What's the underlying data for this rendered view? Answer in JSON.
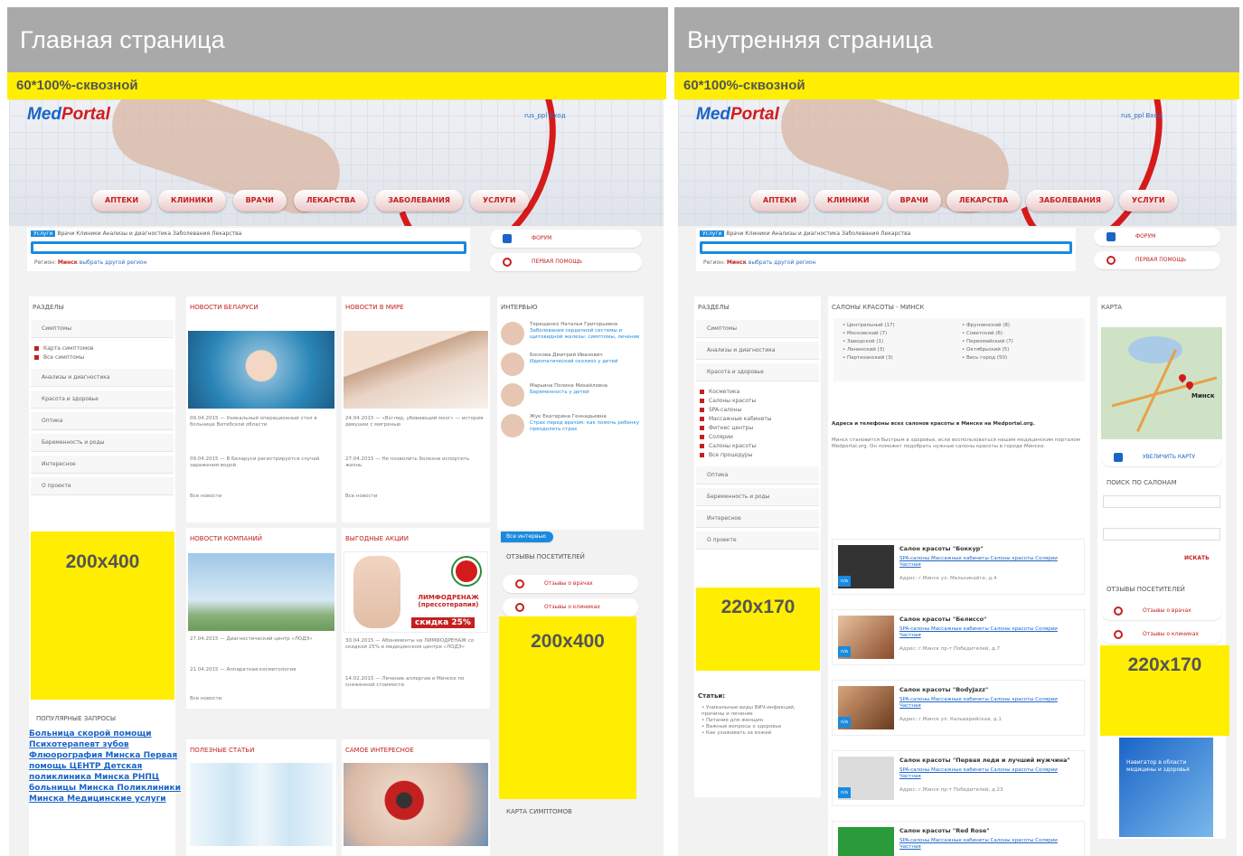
{
  "headers": {
    "main": "Главная страница",
    "inner": "Внутренняя страница"
  },
  "banners": {
    "main": "60*100%-сквозной",
    "inner": "60*100%-сквозной"
  },
  "logo": {
    "med": "Med",
    "portal": "Portal"
  },
  "nav": [
    "АПТЕКИ",
    "КЛИНИКИ",
    "ВРАЧИ",
    "ЛЕКАРСТВА",
    "ЗАБОЛЕВАНИЯ",
    "УСЛУГИ"
  ],
  "search": {
    "tabs": [
      "Услуги",
      "Врачи",
      "Клиники",
      "Анализы и диагностика",
      "Заболевания",
      "Лекарства"
    ],
    "region_label": "Регион:",
    "region_value": "Минск",
    "region_link": "выбрать другой регион"
  },
  "quick": {
    "forum": "ФОРУМ",
    "first_aid": "ПЕРВАЯ ПОМОЩЬ"
  },
  "main": {
    "sections_title": "РАЗДЕЛЫ",
    "sections": [
      "Симптомы",
      "Анализы и диагностика",
      "Красота и здоровье",
      "Оптика",
      "Беременность и роды",
      "Интересное",
      "О проекте"
    ],
    "sublist": [
      "Карта симптомов",
      "Все симптомы"
    ],
    "ad1": "200x400",
    "ad2": "200x400",
    "news_by": "НОВОСТИ БЕЛАРУСИ",
    "news_world": "НОВОСТИ В МИРЕ",
    "interview": "ИНТЕРВЬЮ",
    "company_news": "НОВОСТИ КОМПАНИЙ",
    "deals": "ВЫГОДНЫЕ АКЦИИ",
    "visitors": "ОТЗЫВЫ ПОСЕТИТЕЛЕЙ",
    "useful": "ПОЛЕЗНЫЕ СТАТЬИ",
    "interesting": "САМОЕ ИНТЕРЕСНОЕ",
    "symptom_map": "КАРТА СИМПТОМОВ",
    "popular_title": "ПОПУЛЯРНЫЕ ЗАПРОСЫ",
    "popular": "Больница скорой помощи Психотерапевт зубов Флюорография Минска Первая помощь ЦЕНТР Детская поликлиника Минска РНПЦ больницы Минска Поликлиники Минска Медицинские услуги",
    "promo_title": "ЛИМФОДРЕНАЖ (прессотерапия)",
    "promo_discount": "скидка 25%",
    "all_news": "Все новости",
    "review_doctors": "Отзывы о врачах",
    "review_clinics": "Отзывы о клиниках",
    "all_interviews": "Все интервью"
  },
  "inner": {
    "sections_title": "РАЗДЕЛЫ",
    "sections": [
      "Симптомы",
      "Анализы и диагностика",
      "Красота и здоровье",
      "Оптика",
      "Беременность и роды",
      "Интересное",
      "О проекте"
    ],
    "sublist": [
      "Косметика",
      "Салоны красоты",
      "SPA-салоны",
      "Массажные кабинеты",
      "Фитнес центры",
      "Солярии",
      "Салоны красоты",
      "Все процедуры"
    ],
    "ad_left": "220x170",
    "ad_right": "220x170",
    "center_title": "САЛОНЫ КРАСОТЫ - МИНСК",
    "map_title": "КАРТА",
    "map_city": "Минск",
    "search_title": "ПОИСК ПО САЛОНАМ",
    "visitors_title": "ОТЗЫВЫ ПОСЕТИТЕЛЕЙ",
    "articles": "Статьи:",
    "salons": [
      {
        "name": "Салон красоты \"Боккур\""
      },
      {
        "name": "Салон красоты \"Белиссо\""
      },
      {
        "name": "Салон красоты \"BodyJazz\""
      },
      {
        "name": "Салон красоты \"Первая леди и лучший мужчина\""
      },
      {
        "name": "Салон красоты \"Red Rose\""
      }
    ],
    "salon_links": "SPA-салоны Массажные кабинеты Салоны красоты Солярии Частная",
    "navigator": "Навигатор в области медицины и здоровья"
  }
}
